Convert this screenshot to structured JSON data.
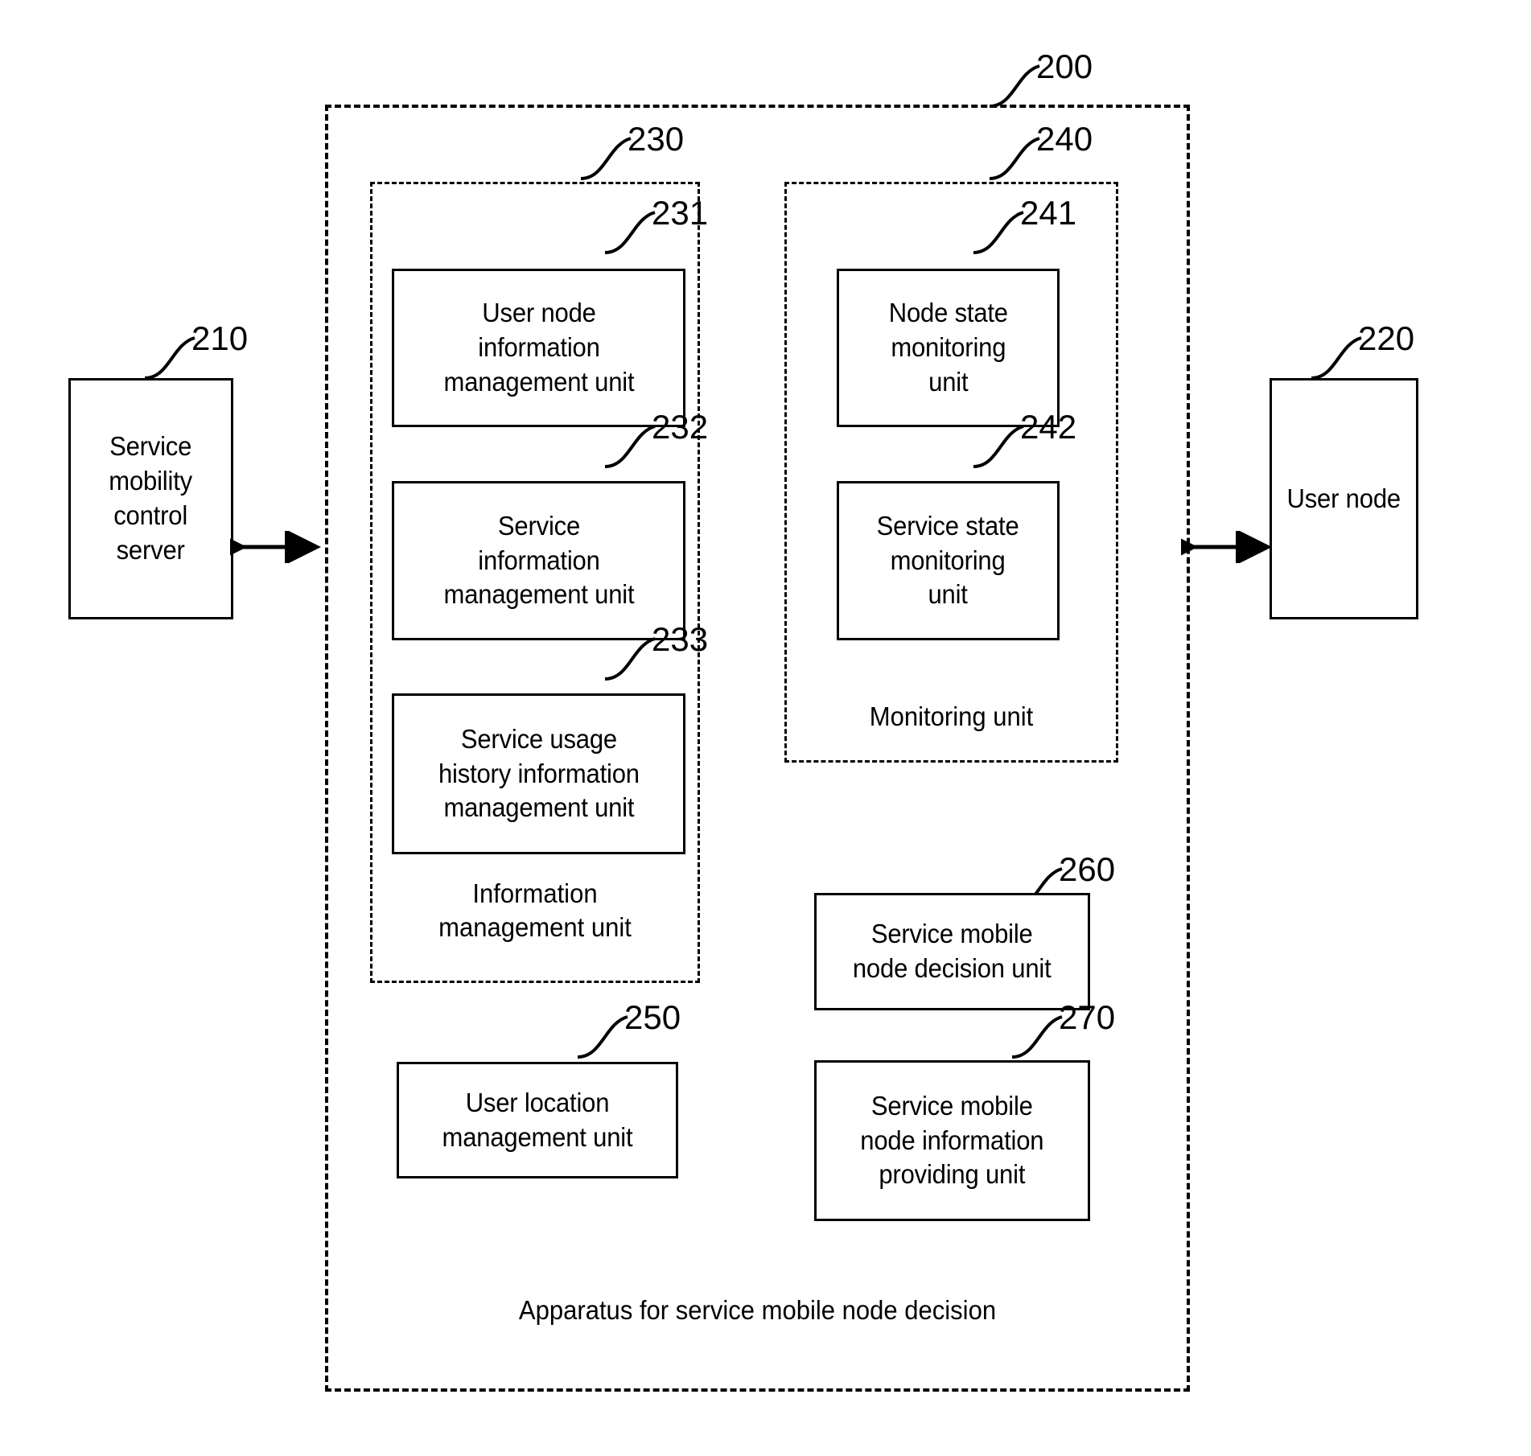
{
  "figure": {
    "title": "Apparatus for service mobile node decision block diagram",
    "outer_label": "Apparatus for service mobile node decision",
    "outer_ref": "200"
  },
  "external": {
    "left": {
      "ref": "210",
      "lines": [
        "Service",
        "mobility",
        "control",
        "server"
      ]
    },
    "right": {
      "ref": "220",
      "lines": [
        "User node"
      ]
    }
  },
  "groups": {
    "information_management": {
      "ref": "230",
      "label": "Information\nmanagement unit",
      "label_line1": "Information",
      "label_line2": "management unit",
      "children": [
        {
          "ref": "231",
          "line1": "User node",
          "line2": "information",
          "line3": "management unit"
        },
        {
          "ref": "232",
          "line1": "Service",
          "line2": "information",
          "line3": "management unit"
        },
        {
          "ref": "233",
          "line1": "Service usage",
          "line2": "history information",
          "line3": "management unit"
        }
      ]
    },
    "monitoring": {
      "ref": "240",
      "label": "Monitoring unit",
      "children": [
        {
          "ref": "241",
          "line1": "Node state",
          "line2": "monitoring",
          "line3": "unit"
        },
        {
          "ref": "242",
          "line1": "Service state",
          "line2": "monitoring",
          "line3": "unit"
        }
      ]
    }
  },
  "units": {
    "user_location": {
      "ref": "250",
      "line1": "User location",
      "line2": "management unit"
    },
    "decision": {
      "ref": "260",
      "line1": "Service mobile",
      "line2": "node decision unit"
    },
    "info_providing": {
      "ref": "270",
      "line1": "Service mobile",
      "line2": "node information",
      "line3": "providing unit"
    }
  },
  "connectors": {
    "left_arrow": "bidirectional-arrow",
    "right_arrow": "bidirectional-arrow"
  },
  "style": {
    "ink": "#000000",
    "paper": "#ffffff"
  }
}
